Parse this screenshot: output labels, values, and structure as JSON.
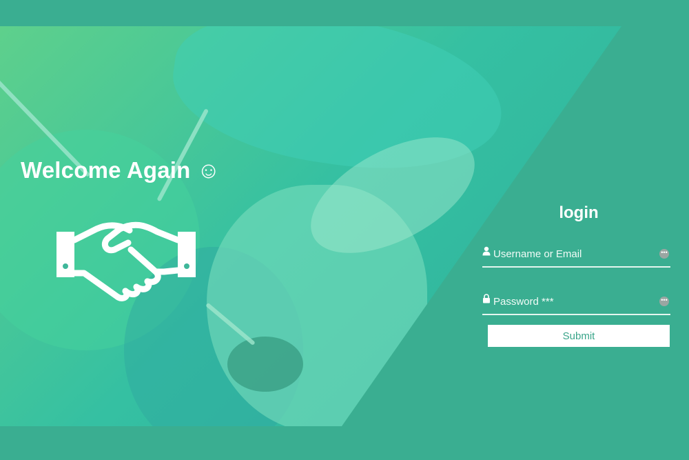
{
  "hero": {
    "welcome_text": "Welcome Again ☺",
    "handshake_icon": "handshake-icon"
  },
  "login": {
    "title": "login",
    "username": {
      "placeholder": "Username or Email",
      "value": "",
      "icon": "user-icon"
    },
    "password": {
      "placeholder": "Password ***",
      "value": "",
      "icon": "lock-icon"
    },
    "field_menu_glyph": "•••",
    "submit_label": "Submit"
  },
  "colors": {
    "brand": "#3aae91",
    "hero_gradient_start": "#5ed08c",
    "button_text": "#3aa58a"
  }
}
